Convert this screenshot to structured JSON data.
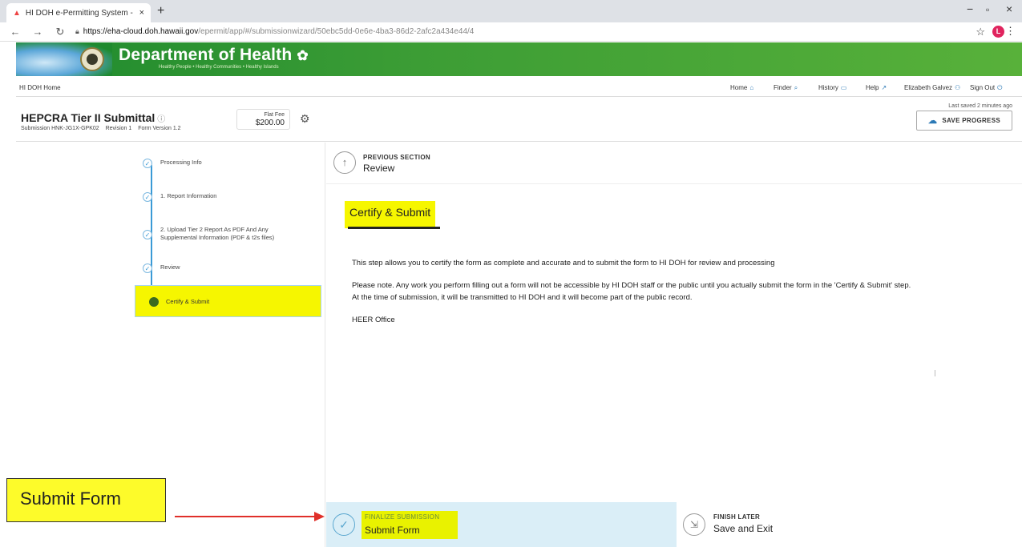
{
  "browser": {
    "tab_title": "HI DOH e-Permitting System - H",
    "tab_close": "×",
    "new_tab": "+",
    "url_host": "https://eha-cloud.doh.hawaii.gov",
    "url_path": "/epermit/app/#/submissionwizard/50ebc5dd-0e6e-4ba3-86d2-2afc2a434e44/4",
    "profile_initial": "L",
    "minimize": "−",
    "maximize": "▫",
    "close": "×"
  },
  "banner": {
    "title": "Department of Health",
    "tagline": "Healthy People • Healthy Communities • Healthy Islands"
  },
  "appnav": {
    "home_label": "HI DOH Home",
    "links": [
      {
        "label": "Home",
        "icon": "⌂"
      },
      {
        "label": "Finder",
        "icon": "⌕"
      },
      {
        "label": "History",
        "icon": "▭"
      },
      {
        "label": "Help",
        "icon": "↗"
      },
      {
        "label": "Elizabeth Galvez",
        "icon": "⚇"
      },
      {
        "label": "Sign Out",
        "icon": "⏻"
      }
    ]
  },
  "form": {
    "title": "HEPCRA Tier II Submittal",
    "help_icon": "ⓘ",
    "submission": "Submission HNK-JG1X-GPK02",
    "revision": "Revision 1",
    "version": "Form Version 1.2",
    "fee_label": "Flat Fee",
    "fee_amount": "$200.00",
    "last_saved": "Last saved 2 minutes ago",
    "save_label": "SAVE PROGRESS"
  },
  "steps": [
    {
      "label": "Processing Info"
    },
    {
      "label": "1. Report Information"
    },
    {
      "label": "2. Upload Tier 2 Report As PDF And Any Supplemental Information (PDF & t2s files)"
    },
    {
      "label": "Review"
    }
  ],
  "active_step": {
    "label": "Certify & Submit"
  },
  "main": {
    "prev_caption": "PREVIOUS SECTION",
    "prev_name": "Review",
    "heading": "Certify & Submit",
    "paragraphs": [
      "This step allows you to certify the form as complete and accurate and to submit the form to HI DOH for review and processing",
      "Please note. Any work you perform filling out a form will not be accessible by HI DOH staff or the public until you actually submit the form in the 'Certify & Submit' step. At the time of submission, it will be transmitted to HI DOH and it will become part of the public record.",
      "HEER Office"
    ]
  },
  "footer": {
    "finalize_caption": "FINALIZE SUBMISSION",
    "finalize_label": "Submit Form",
    "finish_caption": "FINISH LATER",
    "finish_label": "Save and Exit"
  },
  "annotation": {
    "callout": "Submit Form"
  }
}
